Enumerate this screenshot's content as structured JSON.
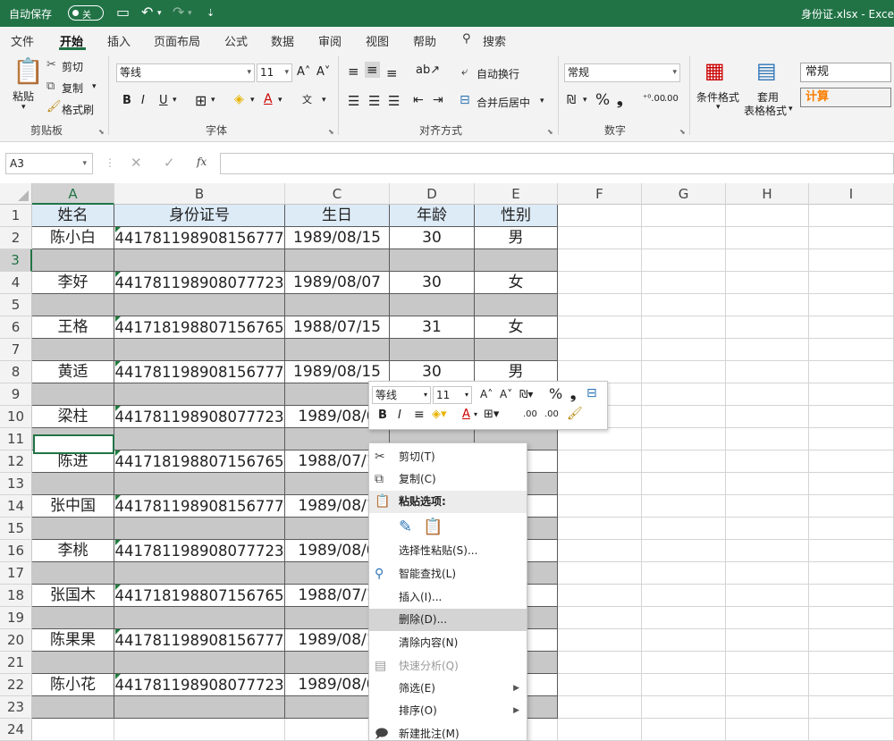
{
  "titlebar": {
    "autosave_label": "自动保存",
    "toggle_state": "关",
    "filename": "身份证.xlsx - Exce"
  },
  "menu": {
    "tabs": [
      "文件",
      "开始",
      "插入",
      "页面布局",
      "公式",
      "数据",
      "审阅",
      "视图",
      "帮助",
      "搜索"
    ],
    "active_tab": "开始"
  },
  "ribbon": {
    "clipboard": {
      "paste": "粘贴",
      "cut": "剪切",
      "copy": "复制",
      "format_painter": "格式刷",
      "label": "剪贴板"
    },
    "font": {
      "name": "等线",
      "size": "11",
      "label": "字体"
    },
    "alignment": {
      "wrap_text": "自动换行",
      "merge_center": "合并后居中",
      "label": "对齐方式"
    },
    "number": {
      "format": "常规",
      "label": "数字"
    },
    "styles": {
      "conditional_format": "条件格式",
      "format_as_table_1": "套用",
      "format_as_table_2": "表格格式",
      "style_normal": "常规",
      "style_calc": "计算"
    }
  },
  "formula_bar": {
    "name_box": "A3",
    "fx": "fx",
    "value": ""
  },
  "grid": {
    "columns": [
      "A",
      "B",
      "C",
      "D",
      "E",
      "F",
      "G",
      "H",
      "I"
    ],
    "rows": [
      "1",
      "2",
      "3",
      "4",
      "5",
      "6",
      "7",
      "8",
      "9",
      "10",
      "11",
      "12",
      "13",
      "14",
      "15",
      "16",
      "17",
      "18",
      "19",
      "20",
      "21",
      "22",
      "23",
      "24"
    ],
    "header": [
      "姓名",
      "身份证号",
      "生日",
      "年龄",
      "性别"
    ],
    "records": [
      [
        "陈小白",
        "441781198908156777",
        "1989/08/15",
        "30",
        "男"
      ],
      [
        "李好",
        "441781198908077723",
        "1989/08/07",
        "30",
        "女"
      ],
      [
        "王格",
        "441718198807156765",
        "1988/07/15",
        "31",
        "女"
      ],
      [
        "黄适",
        "441781198908156777",
        "1989/08/15",
        "30",
        "男"
      ],
      [
        "梁柱",
        "441781198908077723",
        "1989/08/0",
        "",
        ""
      ],
      [
        "陈进",
        "441718198807156765",
        "1988/07/1",
        "",
        ""
      ],
      [
        "张中国",
        "441781198908156777",
        "1989/08/1",
        "",
        ""
      ],
      [
        "李桃",
        "441781198908077723",
        "1989/08/0",
        "",
        ""
      ],
      [
        "张国木",
        "441718198807156765",
        "1988/07/1",
        "",
        ""
      ],
      [
        "陈果果",
        "441781198908156777",
        "1989/08/1",
        "",
        ""
      ],
      [
        "陈小花",
        "441781198908077723",
        "1989/08/0",
        "",
        ""
      ]
    ]
  },
  "mini_toolbar": {
    "font": "等线",
    "size": "11",
    "percent": "%",
    "comma": "❟",
    "bold": "B",
    "italic": "I",
    "decimals": ".00"
  },
  "context_menu": {
    "items": [
      {
        "label": "剪切(T)",
        "icon": "scissors-icon"
      },
      {
        "label": "复制(C)",
        "icon": "copy-icon"
      },
      {
        "label": "粘贴选项:",
        "icon": "paste-icon"
      },
      {
        "label": "",
        "icon": "paste-options-icons"
      },
      {
        "label": "选择性粘贴(S)...",
        "icon": ""
      },
      {
        "label": "智能查找(L)",
        "icon": "smart-lookup-icon"
      },
      {
        "label": "插入(I)...",
        "icon": ""
      },
      {
        "label": "删除(D)...",
        "icon": ""
      },
      {
        "label": "清除内容(N)",
        "icon": ""
      },
      {
        "label": "快速分析(Q)",
        "icon": "quick-analysis-icon"
      },
      {
        "label": "筛选(E)",
        "icon": ""
      },
      {
        "label": "排序(O)",
        "icon": ""
      },
      {
        "label": "新建批注(M)",
        "icon": "comment-icon"
      }
    ],
    "hovered": "删除(D)..."
  },
  "colors": {
    "excel_green": "#217346",
    "header_fill": "#ddebf7",
    "gray_row": "#c8c8c8"
  }
}
